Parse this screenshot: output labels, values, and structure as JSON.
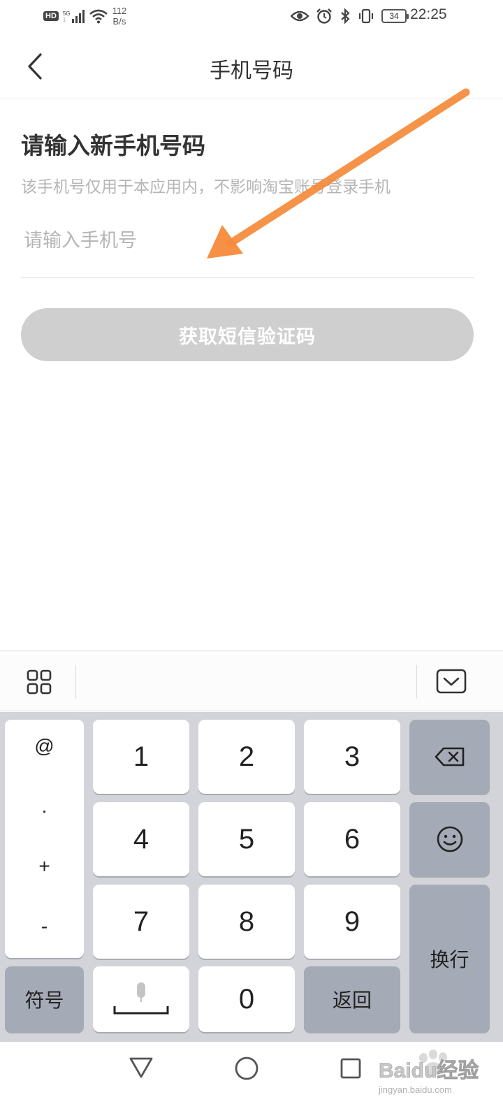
{
  "status_bar": {
    "hd": "HD",
    "network": "5G",
    "network_sub": "1",
    "speed_value": "112",
    "speed_unit": "B/s",
    "battery": "34",
    "time": "22:25"
  },
  "nav": {
    "title": "手机号码",
    "back_icon": "chevron-left-icon"
  },
  "form": {
    "heading": "请输入新手机号码",
    "note": "该手机号仅用于本应用内，不影响淘宝账号登录手机",
    "phone_placeholder": "请输入手机号",
    "phone_value": "",
    "sms_button": "获取短信验证码",
    "sms_button_color": "#cfcfcf"
  },
  "annotation": {
    "arrow_color": "#f58a3a",
    "icon": "arrow-annotation-icon"
  },
  "keyboard_toolbar": {
    "left_icon": "grid-menu-icon",
    "right_icon": "keyboard-hide-icon"
  },
  "keyboard": {
    "symbols": [
      "@",
      ".",
      "+",
      "-"
    ],
    "digits": [
      "1",
      "2",
      "3",
      "4",
      "5",
      "6",
      "7",
      "8",
      "9",
      "0"
    ],
    "symbol_key": "符号",
    "back_key": "返回",
    "enter_key": "换行",
    "backspace_icon": "backspace-icon",
    "emoji_icon": "smiley-icon",
    "mic_icon": "microphone-icon"
  },
  "system_nav": {
    "back_icon": "triangle-back-icon",
    "home_icon": "circle-home-icon",
    "recent_icon": "square-recents-icon"
  },
  "watermark": {
    "text": "Baidu经验",
    "url_text": "jingyan.baidu.com"
  }
}
